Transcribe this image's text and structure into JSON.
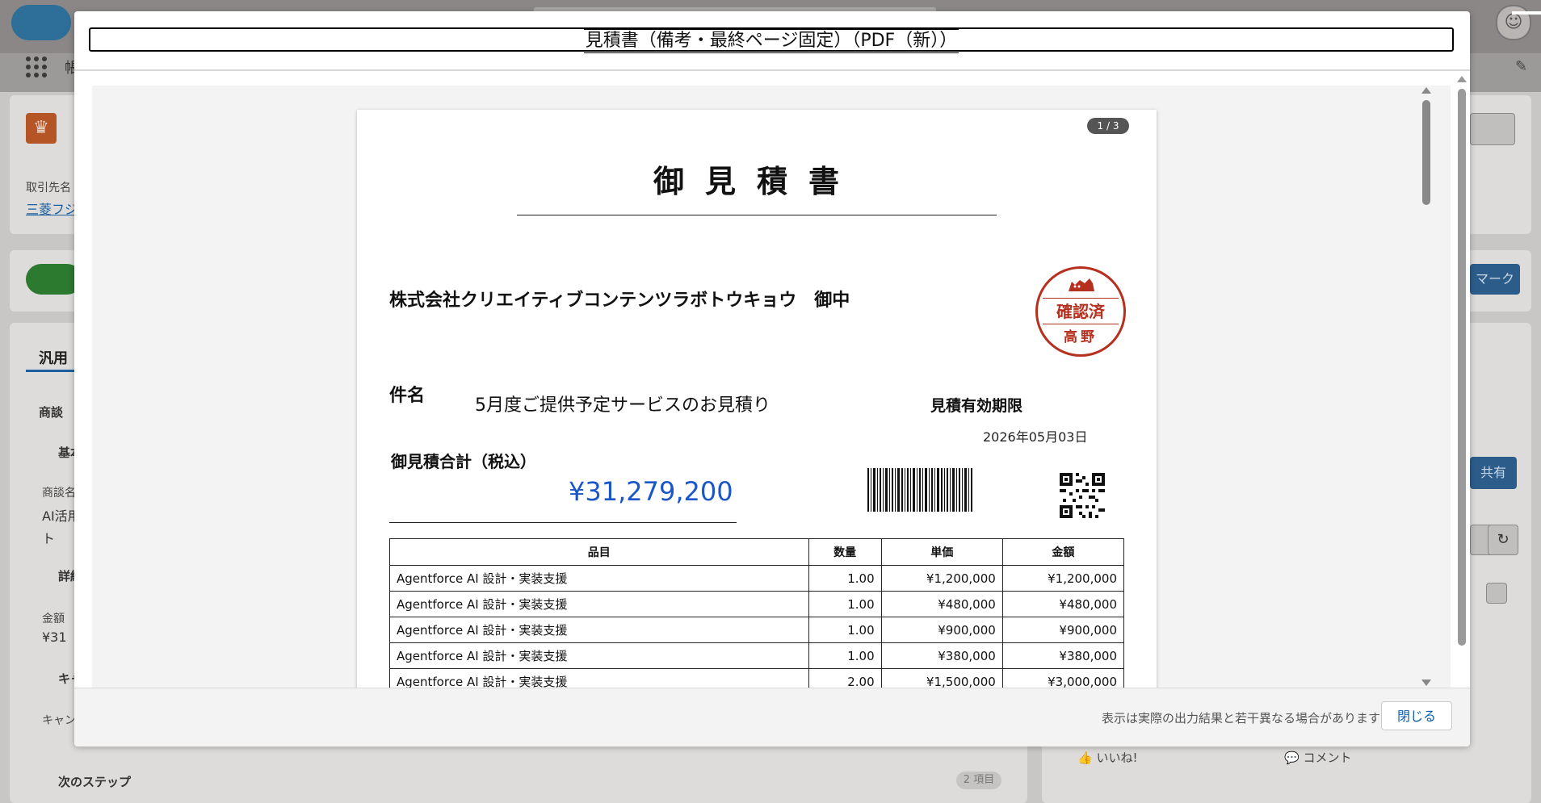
{
  "background": {
    "app_name": "帳",
    "account_label": "取引先名",
    "account_link": "三菱フジ",
    "tab_label": "汎用",
    "section_deal": "商談",
    "section_basic": "基本",
    "field_deal_name_label": "商談名",
    "field_deal_name_value_1": "AI活用",
    "field_deal_name_value_2": "ト",
    "section_detail": "詳細",
    "field_amount_label": "金額",
    "field_amount_value": "¥31",
    "section_campaign": "キャ",
    "field_campaign_label": "キャン",
    "section_next_steps": "次のステップ",
    "next_steps_count": "2 項目",
    "mark_button": "マーク",
    "share_button": "共有",
    "like_label": "いいね!",
    "comment_label": "コメント"
  },
  "modal": {
    "title": "見積書（備考・最終ページ固定）（PDF（新））",
    "footer_note": "表示は実際の出力結果と若干異なる場合があります",
    "close_button": "閉じる"
  },
  "document": {
    "page_indicator": "1 / 3",
    "title": "御見積書",
    "customer": "株式会社クリエイティブコンテンツラボトウキョウ　御中",
    "stamp_main": "確認済",
    "stamp_name": "高野",
    "subject_label": "件名",
    "subject_value": "5月度ご提供予定サービスのお見積り",
    "valid_label": "見積有効期限",
    "valid_date": "2026年05月03日",
    "total_label": "御見積合計（税込）",
    "total_value": "¥31,279,200",
    "table_headers": [
      "品目",
      "数量",
      "単価",
      "金額"
    ],
    "rows": [
      {
        "item": "Agentforce AI 設計・実装支援",
        "qty": "1.00",
        "unit_price": "¥1,200,000",
        "amount": "¥1,200,000"
      },
      {
        "item": "Agentforce AI 設計・実装支援",
        "qty": "1.00",
        "unit_price": "¥480,000",
        "amount": "¥480,000"
      },
      {
        "item": "Agentforce AI 設計・実装支援",
        "qty": "1.00",
        "unit_price": "¥900,000",
        "amount": "¥900,000"
      },
      {
        "item": "Agentforce AI 設計・実装支援",
        "qty": "1.00",
        "unit_price": "¥380,000",
        "amount": "¥380,000"
      },
      {
        "item": "Agentforce AI 設計・実装支援",
        "qty": "2.00",
        "unit_price": "¥1,500,000",
        "amount": "¥3,000,000"
      }
    ]
  },
  "colors": {
    "total_accent": "#1a56c8",
    "stamp_red": "#b5301f",
    "link_blue": "#0b5cab"
  },
  "icons": {
    "app_launcher": "app-grid-icon",
    "record_type": "crown-icon",
    "stamp_figure": "cat-icon",
    "barcode": "barcode-icon",
    "qr": "qr-code-icon"
  }
}
